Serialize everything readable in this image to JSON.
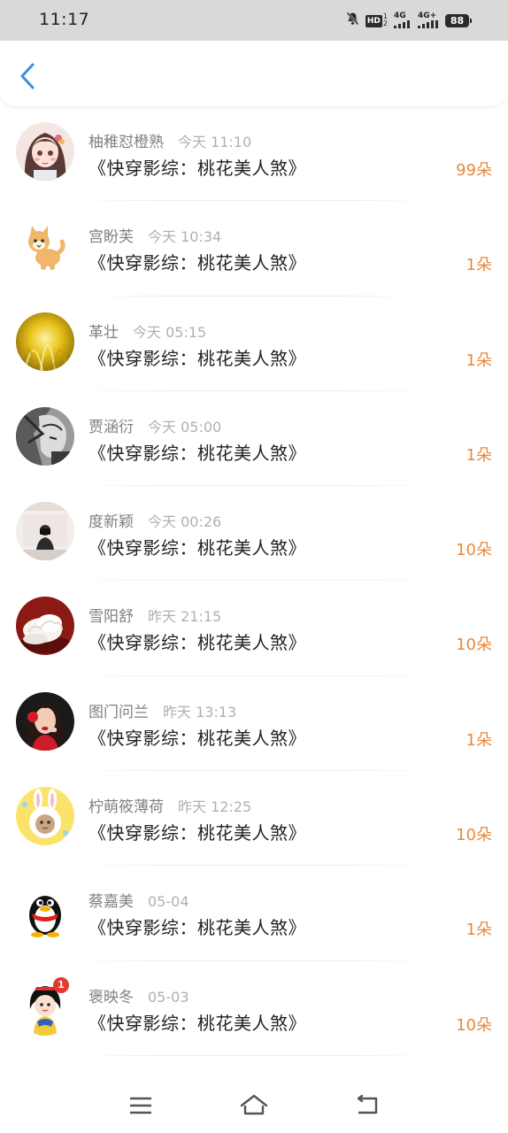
{
  "status_bar": {
    "time": "11:17",
    "hd_label": "HD",
    "hd_sub": "2",
    "hd_sup": "1",
    "net1": "4G",
    "net2": "4G+",
    "battery": "88"
  },
  "header": {
    "back_icon": "chevron-left-icon",
    "accent_color": "#3a8fe0"
  },
  "list": {
    "accent_color": "#e8893a",
    "items": [
      {
        "name": "柚稚怼橙熟",
        "time": "今天 11:10",
        "book": "《快穿影综：桃花美人煞》",
        "count": "99朵"
      },
      {
        "name": "宫盼芙",
        "time": "今天 10:34",
        "book": "《快穿影综：桃花美人煞》",
        "count": "1朵"
      },
      {
        "name": "革壮",
        "time": "今天 05:15",
        "book": "《快穿影综：桃花美人煞》",
        "count": "1朵"
      },
      {
        "name": "贾涵衍",
        "time": "今天 05:00",
        "book": "《快穿影综：桃花美人煞》",
        "count": "1朵"
      },
      {
        "name": "度新颖",
        "time": "今天 00:26",
        "book": "《快穿影综：桃花美人煞》",
        "count": "10朵"
      },
      {
        "name": "雪阳舒",
        "time": "昨天 21:15",
        "book": "《快穿影综：桃花美人煞》",
        "count": "10朵"
      },
      {
        "name": "图门问兰",
        "time": "昨天 13:13",
        "book": "《快穿影综：桃花美人煞》",
        "count": "1朵"
      },
      {
        "name": "柠萌筱薄荷",
        "time": "昨天 12:25",
        "book": "《快穿影综：桃花美人煞》",
        "count": "10朵"
      },
      {
        "name": "蔡嘉美",
        "time": "05-04",
        "book": "《快穿影综：桃花美人煞》",
        "count": "1朵"
      },
      {
        "name": "褒映冬",
        "time": "05-03",
        "book": "《快穿影综：桃花美人煞》",
        "count": "10朵",
        "badge": "1"
      }
    ]
  },
  "nav_bar": {
    "menu_icon": "menu-icon",
    "home_icon": "home-icon",
    "back_icon": "back-icon"
  }
}
